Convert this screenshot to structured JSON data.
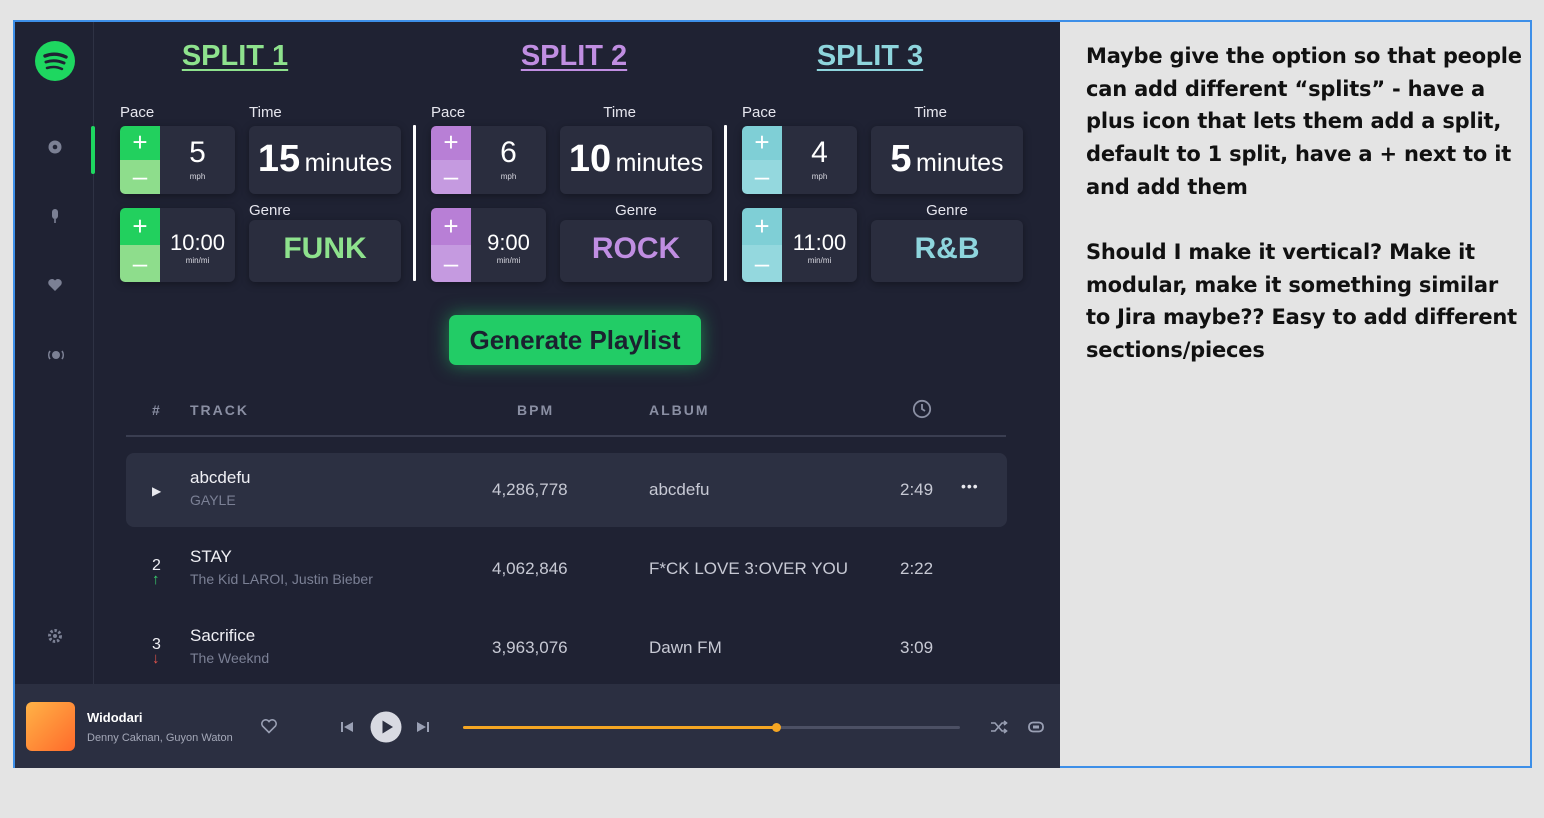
{
  "splits": [
    {
      "title": "SPLIT 1",
      "color": "#8ee28d",
      "plus_color": "#22d05e",
      "minus_color": "#8edd8c",
      "pace_label": "Pace",
      "time_label": "Time",
      "genre_label": "Genre",
      "pace_value": "5",
      "pace_unit": "mph",
      "time_value": "15",
      "time_unit": "minutes",
      "tempo_value": "10:00",
      "tempo_unit": "min/mi",
      "genre": "FUNK"
    },
    {
      "title": "SPLIT 2",
      "color": "#c08ee2",
      "plus_color": "#b87fd6",
      "minus_color": "#c59ae0",
      "pace_label": "Pace",
      "time_label": "Time",
      "genre_label": "Genre",
      "pace_value": "6",
      "pace_unit": "mph",
      "time_value": "10",
      "time_unit": "minutes",
      "tempo_value": "9:00",
      "tempo_unit": "min/mi",
      "genre": "ROCK"
    },
    {
      "title": "SPLIT 3",
      "color": "#8ed5dd",
      "plus_color": "#7fcfd6",
      "minus_color": "#94d8de",
      "pace_label": "Pace",
      "time_label": "Time",
      "genre_label": "Genre",
      "pace_value": "4",
      "pace_unit": "mph",
      "time_value": "5",
      "time_unit": "minutes",
      "tempo_value": "11:00",
      "tempo_unit": "min/mi",
      "genre": "R&B"
    }
  ],
  "plus_symbol": "+",
  "minus_symbol": "–",
  "generate_label": "Generate Playlist",
  "table": {
    "headers": {
      "num": "#",
      "track": "TRACK",
      "bpm": "BPM",
      "album": "ALBUM"
    },
    "rows": [
      {
        "num": "▶",
        "title": "abcdefu",
        "artist": "GAYLE",
        "bpm": "4,286,778",
        "album": "abcdefu",
        "duration": "2:49",
        "trend": "",
        "more": "•••"
      },
      {
        "num": "2",
        "title": "STAY",
        "artist": "The Kid LAROI, Justin Bieber",
        "bpm": "4,062,846",
        "album": "F*CK LOVE 3:OVER YOU",
        "duration": "2:22",
        "trend": "↑"
      },
      {
        "num": "3",
        "title": "Sacrifice",
        "artist": "The Weeknd",
        "bpm": "3,963,076",
        "album": "Dawn FM",
        "duration": "3:09",
        "trend": "↓"
      }
    ]
  },
  "player": {
    "title": "Widodari",
    "artist": "Denny Caknan, Guyon Waton",
    "progress": 0.63
  },
  "notes": [
    "Maybe give the option so that people can add different “splits” - have a plus icon that lets them add a split, default to 1 split, have a + next to it and add them",
    "Should I make it vertical? Make it modular, make it something similar to Jira maybe?? Easy to add different sections/pieces"
  ],
  "icons": {
    "logo": "spotify-logo",
    "sidebar": [
      "home-icon",
      "microphone-icon",
      "heart-icon",
      "radio-icon",
      "settings-icon"
    ],
    "player": [
      "heart-icon",
      "previous-icon",
      "play-icon",
      "next-icon",
      "shuffle-icon",
      "repeat-icon"
    ],
    "clock": "clock-icon"
  }
}
